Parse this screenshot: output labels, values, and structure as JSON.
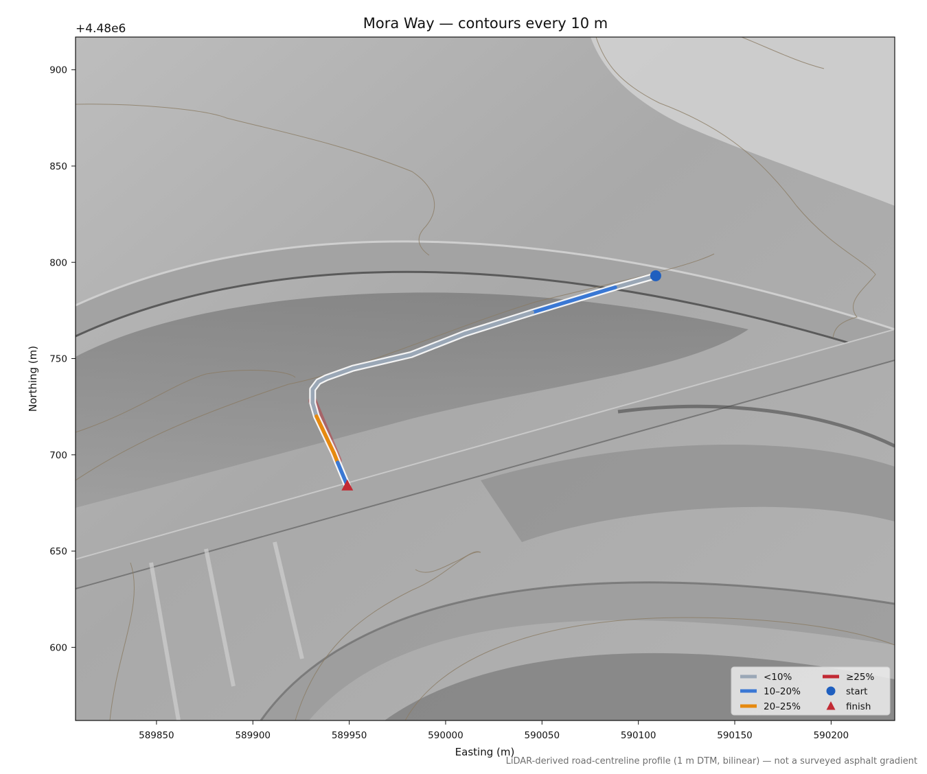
{
  "title": "Mora Way — contours every 10 m",
  "offset_label": "+4.48e6",
  "xlabel": "Easting (m)",
  "ylabel": "Northing (m)",
  "footnote": "LiDAR-derived road-centreline profile (1 m DTM, bilinear) — not a surveyed asphalt gradient",
  "chart_data": {
    "type": "line",
    "title": "Mora Way — contours every 10 m",
    "xlabel": "Easting (m)",
    "ylabel": "Northing (m)",
    "y_offset": 4480000,
    "xlim": [
      589808,
      590233
    ],
    "ylim": [
      4480562,
      4480917
    ],
    "x_ticks": [
      589850,
      589900,
      589950,
      590000,
      590050,
      590100,
      590150,
      590200
    ],
    "y_ticks": [
      600,
      650,
      700,
      750,
      800,
      850,
      900
    ],
    "x_tick_labels": [
      "589850",
      "589900",
      "589950",
      "590000",
      "590050",
      "590100",
      "590150",
      "590200"
    ],
    "y_tick_labels": [
      "600",
      "650",
      "700",
      "750",
      "800",
      "850",
      "900"
    ],
    "grid": false,
    "route": [
      {
        "x": 590109,
        "y": 793,
        "slope": "<10%"
      },
      {
        "x": 590088,
        "y": 787,
        "slope": "10–20%"
      },
      {
        "x": 590045,
        "y": 774,
        "slope": "<10%"
      },
      {
        "x": 590010,
        "y": 763,
        "slope": "<10%"
      },
      {
        "x": 589982,
        "y": 752,
        "slope": "<10%"
      },
      {
        "x": 589952,
        "y": 745,
        "slope": "<10%"
      },
      {
        "x": 589938,
        "y": 740,
        "slope": "<10%"
      },
      {
        "x": 589934,
        "y": 738,
        "slope": "<10%"
      },
      {
        "x": 589931,
        "y": 734,
        "slope": "<10%"
      },
      {
        "x": 589931,
        "y": 727,
        "slope": "<10%"
      },
      {
        "x": 589933,
        "y": 720,
        "slope": "20–25%"
      },
      {
        "x": 589942,
        "y": 701,
        "slope": "20–25%"
      },
      {
        "x": 589944,
        "y": 696,
        "slope": "10–20%"
      },
      {
        "x": 589949,
        "y": 684,
        "slope": "<10%"
      }
    ],
    "steep_overlay": [
      [
        589931,
        728
      ],
      [
        589944,
        697
      ]
    ],
    "start": {
      "x": 590109,
      "y": 793
    },
    "finish": {
      "x": 589949,
      "y": 684
    },
    "legend": {
      "placement": "lower-right",
      "entries": [
        {
          "label": "<10%",
          "kind": "line",
          "color": "#9aa7b6"
        },
        {
          "label": "10–20%",
          "kind": "line",
          "color": "#3a78d4"
        },
        {
          "label": "20–25%",
          "kind": "line",
          "color": "#e6890f"
        },
        {
          "label": "≥25%",
          "kind": "line",
          "color": "#c22a34"
        },
        {
          "label": "start",
          "kind": "circle",
          "color": "#1f5fbf"
        },
        {
          "label": "finish",
          "kind": "triangle",
          "color": "#c22a34"
        }
      ]
    },
    "colors": {
      "<10%": "#9aa7b6",
      "10–20%": "#3a78d4",
      "20–25%": "#e6890f",
      "≥25%": "#c22a34",
      "start": "#1f5fbf",
      "finish": "#c22a34",
      "contour": "#8a7a62"
    }
  }
}
